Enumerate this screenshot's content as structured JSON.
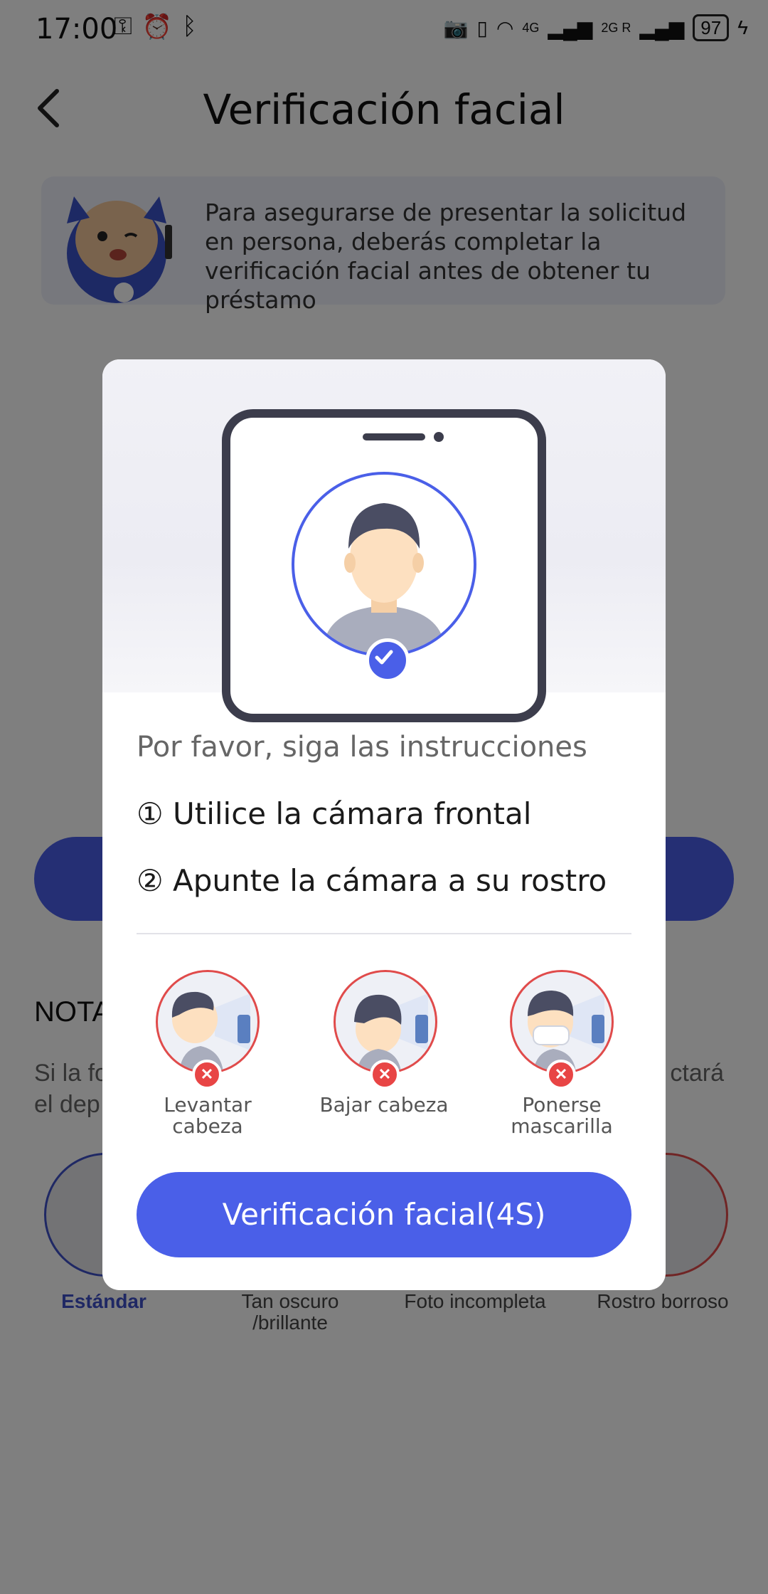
{
  "status_bar": {
    "time": "17:00",
    "battery": "97",
    "network_a": "4G",
    "network_b": "2G R"
  },
  "header": {
    "title": "Verificación facial"
  },
  "info_card": {
    "text": "Para asegurarse de presentar la solicitud en persona, deberás completar la verificación facial antes de obtener tu préstamo"
  },
  "background": {
    "notice_title": "NOTA",
    "notice_text_left": "Si la fo",
    "notice_text_left2": "el dep",
    "notice_text_right": "ctará",
    "examples": [
      {
        "label": "Estándar",
        "color": "#3f51c8"
      },
      {
        "label": "Tan oscuro /brillante",
        "color": "#444444"
      },
      {
        "label": "Foto incompleta",
        "color": "#444444"
      },
      {
        "label": "Rostro borroso",
        "color": "#444444"
      }
    ]
  },
  "modal": {
    "subtitle": "Por favor, siga las instrucciones",
    "steps": [
      "① Utilice la cámara frontal",
      "② Apunte la cámara a su rostro"
    ],
    "bad_examples": [
      {
        "label": "Levantar cabeza",
        "icon": "head-up-icon"
      },
      {
        "label": "Bajar cabeza",
        "icon": "head-down-icon"
      },
      {
        "label": "Ponerse mascarilla",
        "icon": "mask-icon"
      }
    ],
    "button_label": "Verificación facial(4S)"
  },
  "colors": {
    "accent": "#4a5fe8",
    "error": "#e04b4b"
  }
}
